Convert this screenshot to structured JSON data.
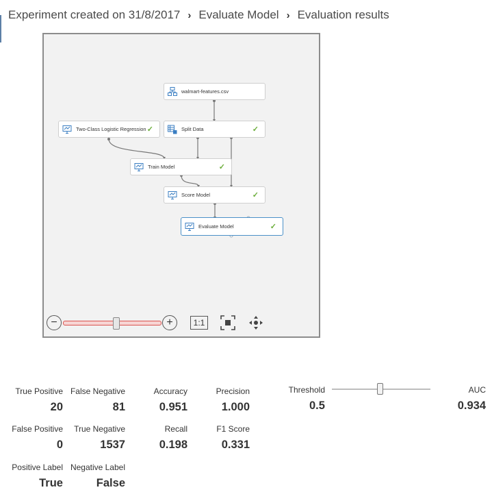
{
  "breadcrumb": {
    "items": [
      "Experiment created on 31/8/2017",
      "Evaluate Model",
      "Evaluation results"
    ],
    "separator": "›"
  },
  "graph": {
    "nodes": [
      {
        "id": "walmart",
        "label": "walmart-features.csv",
        "icon": "dataset-icon",
        "checked": false
      },
      {
        "id": "logreg",
        "label": "Two-Class Logistic Regression",
        "icon": "module-icon",
        "checked": true
      },
      {
        "id": "split",
        "label": "Split Data",
        "icon": "split-data-icon",
        "checked": true
      },
      {
        "id": "train",
        "label": "Train Model",
        "icon": "module-icon",
        "checked": true
      },
      {
        "id": "score",
        "label": "Score Model",
        "icon": "module-icon",
        "checked": true
      },
      {
        "id": "evaluate",
        "label": "Evaluate Model",
        "icon": "module-icon",
        "checked": true,
        "selected": true
      }
    ],
    "check_glyph": "✓"
  },
  "zoom": {
    "zoom_out": "−",
    "zoom_in": "+",
    "actual_size": "1:1",
    "fit_icon": "fit-to-screen-icon",
    "pan_icon": "pan-icon",
    "level": 0.53
  },
  "metrics": {
    "true_positive": {
      "label": "True Positive",
      "value": "20"
    },
    "false_negative": {
      "label": "False Negative",
      "value": "81"
    },
    "accuracy": {
      "label": "Accuracy",
      "value": "0.951"
    },
    "precision": {
      "label": "Precision",
      "value": "1.000"
    },
    "threshold": {
      "label": "Threshold",
      "value": "0.5"
    },
    "auc": {
      "label": "AUC",
      "value": "0.934"
    },
    "false_positive": {
      "label": "False Positive",
      "value": "0"
    },
    "true_negative": {
      "label": "True Negative",
      "value": "1537"
    },
    "recall": {
      "label": "Recall",
      "value": "0.198"
    },
    "f1_score": {
      "label": "F1 Score",
      "value": "0.331"
    },
    "positive_label": {
      "label": "Positive Label",
      "value": "True"
    },
    "negative_label": {
      "label": "Negative Label",
      "value": "False"
    }
  },
  "colors": {
    "check": "#6cae3b",
    "selected_border": "#4a90c8",
    "zoom_track": "#d9534f",
    "icon_blue": "#3a7ec2"
  }
}
